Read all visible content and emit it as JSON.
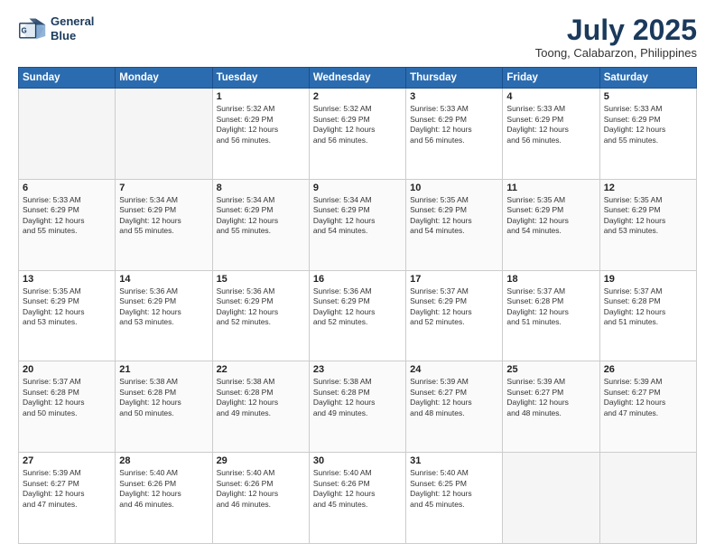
{
  "header": {
    "logo_line1": "General",
    "logo_line2": "Blue",
    "month_year": "July 2025",
    "location": "Toong, Calabarzon, Philippines"
  },
  "weekdays": [
    "Sunday",
    "Monday",
    "Tuesday",
    "Wednesday",
    "Thursday",
    "Friday",
    "Saturday"
  ],
  "weeks": [
    [
      {
        "day": "",
        "info": ""
      },
      {
        "day": "",
        "info": ""
      },
      {
        "day": "1",
        "info": "Sunrise: 5:32 AM\nSunset: 6:29 PM\nDaylight: 12 hours\nand 56 minutes."
      },
      {
        "day": "2",
        "info": "Sunrise: 5:32 AM\nSunset: 6:29 PM\nDaylight: 12 hours\nand 56 minutes."
      },
      {
        "day": "3",
        "info": "Sunrise: 5:33 AM\nSunset: 6:29 PM\nDaylight: 12 hours\nand 56 minutes."
      },
      {
        "day": "4",
        "info": "Sunrise: 5:33 AM\nSunset: 6:29 PM\nDaylight: 12 hours\nand 56 minutes."
      },
      {
        "day": "5",
        "info": "Sunrise: 5:33 AM\nSunset: 6:29 PM\nDaylight: 12 hours\nand 55 minutes."
      }
    ],
    [
      {
        "day": "6",
        "info": "Sunrise: 5:33 AM\nSunset: 6:29 PM\nDaylight: 12 hours\nand 55 minutes."
      },
      {
        "day": "7",
        "info": "Sunrise: 5:34 AM\nSunset: 6:29 PM\nDaylight: 12 hours\nand 55 minutes."
      },
      {
        "day": "8",
        "info": "Sunrise: 5:34 AM\nSunset: 6:29 PM\nDaylight: 12 hours\nand 55 minutes."
      },
      {
        "day": "9",
        "info": "Sunrise: 5:34 AM\nSunset: 6:29 PM\nDaylight: 12 hours\nand 54 minutes."
      },
      {
        "day": "10",
        "info": "Sunrise: 5:35 AM\nSunset: 6:29 PM\nDaylight: 12 hours\nand 54 minutes."
      },
      {
        "day": "11",
        "info": "Sunrise: 5:35 AM\nSunset: 6:29 PM\nDaylight: 12 hours\nand 54 minutes."
      },
      {
        "day": "12",
        "info": "Sunrise: 5:35 AM\nSunset: 6:29 PM\nDaylight: 12 hours\nand 53 minutes."
      }
    ],
    [
      {
        "day": "13",
        "info": "Sunrise: 5:35 AM\nSunset: 6:29 PM\nDaylight: 12 hours\nand 53 minutes."
      },
      {
        "day": "14",
        "info": "Sunrise: 5:36 AM\nSunset: 6:29 PM\nDaylight: 12 hours\nand 53 minutes."
      },
      {
        "day": "15",
        "info": "Sunrise: 5:36 AM\nSunset: 6:29 PM\nDaylight: 12 hours\nand 52 minutes."
      },
      {
        "day": "16",
        "info": "Sunrise: 5:36 AM\nSunset: 6:29 PM\nDaylight: 12 hours\nand 52 minutes."
      },
      {
        "day": "17",
        "info": "Sunrise: 5:37 AM\nSunset: 6:29 PM\nDaylight: 12 hours\nand 52 minutes."
      },
      {
        "day": "18",
        "info": "Sunrise: 5:37 AM\nSunset: 6:28 PM\nDaylight: 12 hours\nand 51 minutes."
      },
      {
        "day": "19",
        "info": "Sunrise: 5:37 AM\nSunset: 6:28 PM\nDaylight: 12 hours\nand 51 minutes."
      }
    ],
    [
      {
        "day": "20",
        "info": "Sunrise: 5:37 AM\nSunset: 6:28 PM\nDaylight: 12 hours\nand 50 minutes."
      },
      {
        "day": "21",
        "info": "Sunrise: 5:38 AM\nSunset: 6:28 PM\nDaylight: 12 hours\nand 50 minutes."
      },
      {
        "day": "22",
        "info": "Sunrise: 5:38 AM\nSunset: 6:28 PM\nDaylight: 12 hours\nand 49 minutes."
      },
      {
        "day": "23",
        "info": "Sunrise: 5:38 AM\nSunset: 6:28 PM\nDaylight: 12 hours\nand 49 minutes."
      },
      {
        "day": "24",
        "info": "Sunrise: 5:39 AM\nSunset: 6:27 PM\nDaylight: 12 hours\nand 48 minutes."
      },
      {
        "day": "25",
        "info": "Sunrise: 5:39 AM\nSunset: 6:27 PM\nDaylight: 12 hours\nand 48 minutes."
      },
      {
        "day": "26",
        "info": "Sunrise: 5:39 AM\nSunset: 6:27 PM\nDaylight: 12 hours\nand 47 minutes."
      }
    ],
    [
      {
        "day": "27",
        "info": "Sunrise: 5:39 AM\nSunset: 6:27 PM\nDaylight: 12 hours\nand 47 minutes."
      },
      {
        "day": "28",
        "info": "Sunrise: 5:40 AM\nSunset: 6:26 PM\nDaylight: 12 hours\nand 46 minutes."
      },
      {
        "day": "29",
        "info": "Sunrise: 5:40 AM\nSunset: 6:26 PM\nDaylight: 12 hours\nand 46 minutes."
      },
      {
        "day": "30",
        "info": "Sunrise: 5:40 AM\nSunset: 6:26 PM\nDaylight: 12 hours\nand 45 minutes."
      },
      {
        "day": "31",
        "info": "Sunrise: 5:40 AM\nSunset: 6:25 PM\nDaylight: 12 hours\nand 45 minutes."
      },
      {
        "day": "",
        "info": ""
      },
      {
        "day": "",
        "info": ""
      }
    ]
  ]
}
